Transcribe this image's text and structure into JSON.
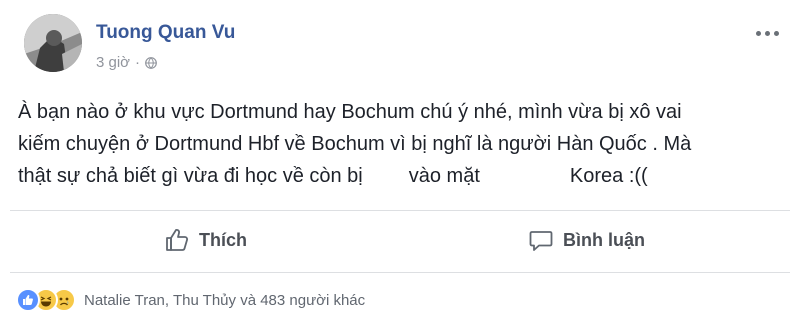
{
  "post": {
    "author": "Tuong Quan Vu",
    "time": "3 giờ",
    "icons": {
      "avatar": "profile-photo",
      "privacy": "globe-icon",
      "more": "more-options-icon"
    },
    "text_lines": [
      "À bạn nào ở khu vực Dortmund hay Bochum chú ý nhé, mình vừa bị xô vai",
      "kiếm chuyện ở Dortmund Hbf về Bochum vì bị nghĩ là người Hàn Quốc . Mà"
    ],
    "line3": {
      "part1": "thật sự chả biết gì vừa đi học về còn bị",
      "part2": "vào mặt",
      "part3": "Korea :(("
    }
  },
  "actions": {
    "like_label": "Thích",
    "comment_label": "Bình luận"
  },
  "reactions": {
    "types": [
      "like",
      "haha",
      "sad"
    ],
    "summary": "Natalie Tran, Thu Thủy và 483 người khác"
  },
  "colors": {
    "author_blue": "#385898",
    "meta_gray": "#90949c",
    "like_blue": "#5890ff",
    "emoji_yellow": "#f7c948"
  }
}
